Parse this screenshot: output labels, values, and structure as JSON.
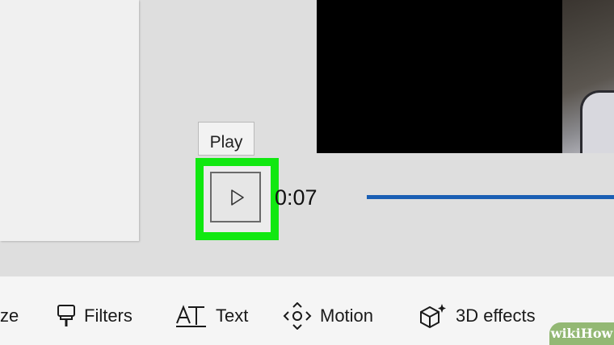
{
  "player": {
    "tooltip": "Play",
    "time": "0:07",
    "play_icon": "play-icon",
    "highlight_color": "#11e811",
    "seek_color": "#1a5fb4"
  },
  "toolbar": {
    "items": [
      {
        "label": "ze",
        "icon": null
      },
      {
        "label": "Filters",
        "icon": "filters-icon"
      },
      {
        "label": "Text",
        "icon": "text-icon"
      },
      {
        "label": "Motion",
        "icon": "motion-icon"
      },
      {
        "label": "3D effects",
        "icon": "3d-effects-icon"
      }
    ]
  },
  "watermark": {
    "brand_prefix": "wiki",
    "brand_suffix": "How"
  }
}
